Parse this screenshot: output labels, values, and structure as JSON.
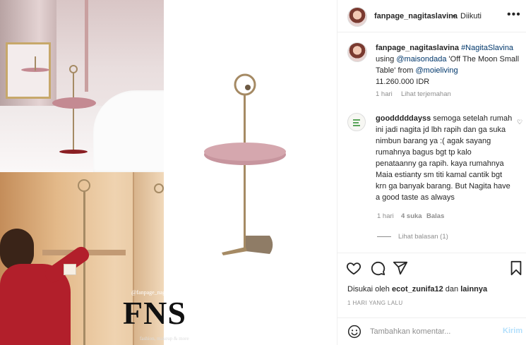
{
  "header": {
    "username": "fanpage_nagitaslavina",
    "separator": "•",
    "follow_label": "Diikuti",
    "more_icon": "more-horizontal-icon"
  },
  "caption": {
    "username": "fanpage_nagitaslavina",
    "hashtag": "#NagitaSlavina",
    "text_1": "using",
    "mention_1": "@maisondada",
    "text_2": "'Off The Moon Small Table' from",
    "mention_2": "@moieliving",
    "price": "11.260.000 IDR",
    "time": "1 hari",
    "translate_label": "Lihat terjemahan"
  },
  "comment": {
    "username": "goodddddayss",
    "text": "semoga setelah rumah ini jadi nagita jd lbh rapih dan ga suka nimbun barang ya :( agak sayang rumahnya bagus bgt tp kalo penataanny ga rapih. kaya rumahnya Maia estianty sm titi kamal cantik bgt krn ga banyak barang. But Nagita have a good taste as always",
    "time": "1 hari",
    "likes": "4 suka",
    "reply_label": "Balas",
    "view_replies": "Lihat balasan (1)"
  },
  "actions": {
    "like_icon": "heart-icon",
    "comment_icon": "comment-icon",
    "share_icon": "share-icon",
    "save_icon": "bookmark-icon"
  },
  "likes": {
    "prefix": "Disukai oleh",
    "user": "ecot_zunifa12",
    "conjunction": "dan",
    "others": "lainnya"
  },
  "post_time": "1 HARI YANG LALU",
  "comment_box": {
    "placeholder": "Tambahkan komentar...",
    "post_label": "Kirim"
  },
  "watermark": {
    "handle": "@fanpage_nagitaslavina",
    "logo": "FNS",
    "tagline": "fashion, makeup & more"
  },
  "colors": {
    "link": "#00376b",
    "muted": "#8e8e8e",
    "post_button": "#b2dffc",
    "table_top": "#c7959e",
    "table_metal": "#a58a64"
  }
}
